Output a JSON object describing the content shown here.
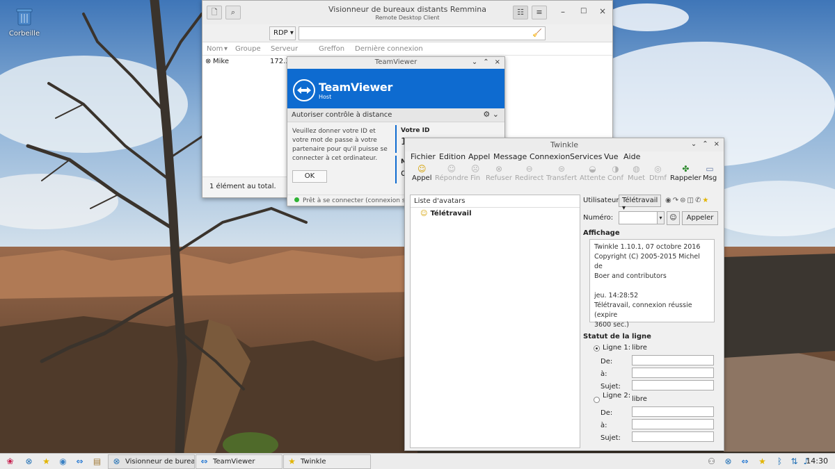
{
  "desktop": {
    "trash_label": "Corbeille"
  },
  "remmina": {
    "title": "Visionneur de bureaux distants Remmina",
    "subtitle": "Remote Desktop Client",
    "protocol": "RDP",
    "columns": [
      "Nom",
      "Groupe",
      "Serveur",
      "Greffon",
      "Dernière connexion"
    ],
    "rows": [
      {
        "name": "Mike",
        "server": "172.3"
      }
    ],
    "status": "1 élément au total."
  },
  "teamviewer": {
    "title": "TeamViewer",
    "brand": "TeamViewer",
    "sub": "Host",
    "section": "Autoriser contrôle à distance",
    "info": "Veuillez donner votre ID et votre mot de passe à votre partenaire pour qu'il puisse se connecter à cet ordinateur.",
    "ok": "OK",
    "id_label": "Votre ID",
    "id_value": "1",
    "pw_label": "M",
    "pw_value": "q",
    "status": "Prêt à se connecter (connexion séc"
  },
  "twinkle": {
    "title": "Twinkle",
    "menu": [
      "Fichier",
      "Edition",
      "Appel",
      "Message",
      "Connexion",
      "Services",
      "Vue",
      "Aide"
    ],
    "tools": [
      {
        "label": "Appel",
        "icon": "☺"
      },
      {
        "label": "Répondre",
        "icon": "☺"
      },
      {
        "label": "Fin",
        "icon": "☹"
      },
      {
        "label": "Refuser",
        "icon": "⊗"
      },
      {
        "label": "Redirect",
        "icon": "⊖"
      },
      {
        "label": "Transfert",
        "icon": "⊜"
      },
      {
        "label": "Attente",
        "icon": "◒"
      },
      {
        "label": "Conf",
        "icon": "◑"
      },
      {
        "label": "Muet",
        "icon": "◍"
      },
      {
        "label": "Dtmf",
        "icon": "◎"
      },
      {
        "label": "Rappeler",
        "icon": "✤"
      },
      {
        "label": "Msg",
        "icon": "▭"
      }
    ],
    "avatar_list_header": "Liste d'avatars",
    "avatar_item": "Télétravail",
    "user_label": "Utilisateur:",
    "user_value": "Télétravail",
    "number_label": "Numéro:",
    "call_button": "Appeler",
    "display_header": "Affichage",
    "display_lines": [
      "Twinkle 1.10.1, 07 octobre 2016",
      "Copyright (C) 2005-2015  Michel de",
      "Boer and contributors",
      "",
      "jeu. 14:28:52",
      "Télétravail, connexion réussie (expire",
      "3600 sec.)"
    ],
    "line_status_header": "Statut de la ligne",
    "line1_label": "Ligne 1:",
    "line1_state": "libre",
    "line2_label": "Ligne 2:",
    "line2_state": "libre",
    "from_label": "De:",
    "to_label": "à:",
    "subject_label": "Sujet:"
  },
  "taskbar": {
    "tasks": [
      {
        "label": "Visionneur de bureau..."
      },
      {
        "label": "TeamViewer"
      },
      {
        "label": "Twinkle"
      }
    ],
    "clock": "14:30"
  }
}
